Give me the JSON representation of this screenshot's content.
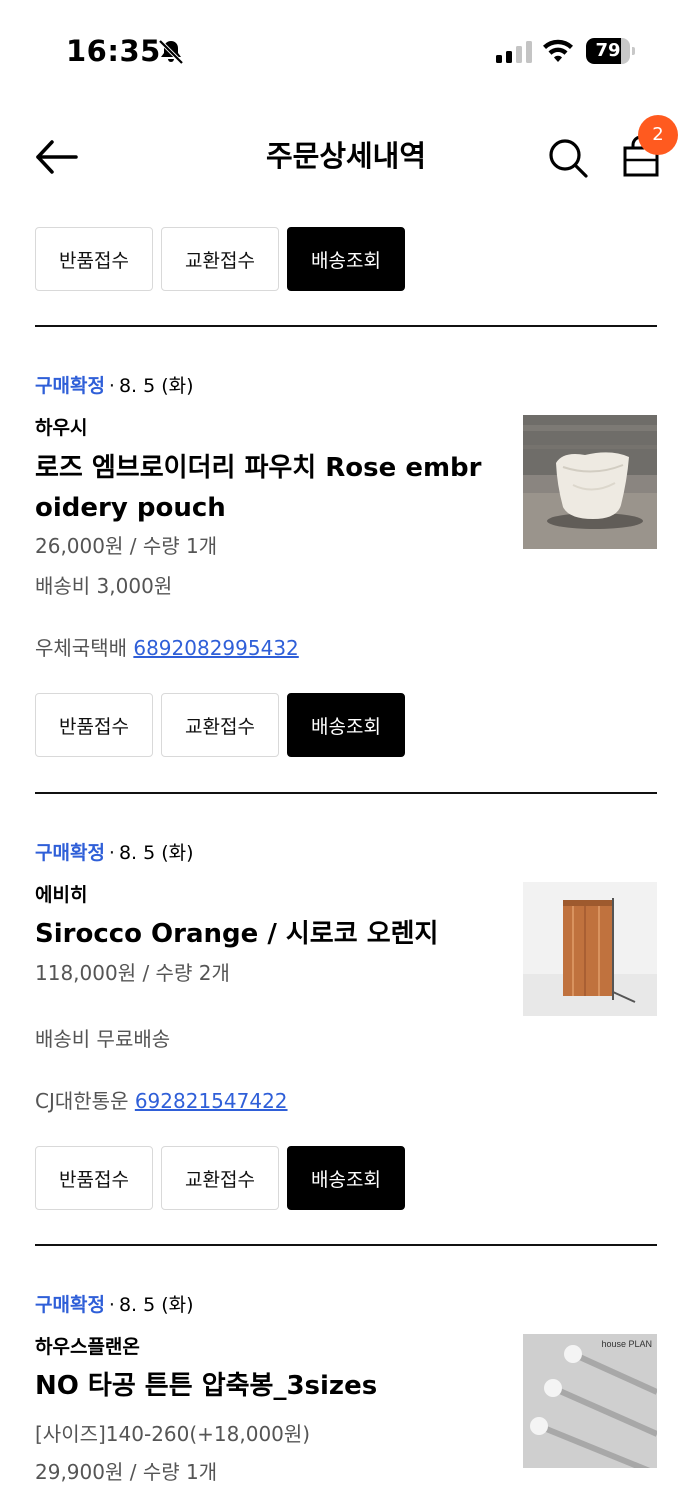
{
  "status_bar": {
    "time": "16:35",
    "battery": "79"
  },
  "header": {
    "title": "주문상세내역",
    "cart_count": "2"
  },
  "actions": {
    "return": "반품접수",
    "exchange": "교환접수",
    "track": "배송조회"
  },
  "orders": [
    {
      "status": "구매확정",
      "separator": "·",
      "date": "8. 5 (화)",
      "shop": "하우시",
      "name": "로즈 엠브로이더리 파우치 Rose embroidery pouch",
      "price_qty": "26,000원 / 수량 1개",
      "shipping": "배송비 3,000원",
      "carrier": "우체국택배",
      "tracking_no": "6892082995432"
    },
    {
      "status": "구매확정",
      "separator": "·",
      "date": "8. 5 (화)",
      "shop": "에비히",
      "name": "Sirocco Orange / 시로코 오렌지",
      "price_qty": "118,000원 / 수량 2개",
      "shipping": "배송비 무료배송",
      "carrier": "CJ대한통운",
      "tracking_no": "692821547422"
    },
    {
      "status": "구매확정",
      "separator": "·",
      "date": "8. 5 (화)",
      "shop": "하우스플랜온",
      "name": "NO 타공 튼튼 압축봉_3sizes",
      "option": "[사이즈]140-260(+18,000원)",
      "price_qty": "29,900원 / 수량 1개",
      "thumb_brand": "house PLAN"
    }
  ],
  "colors": {
    "status": "#2f5fd8",
    "badge": "#ff5a1f"
  },
  "icons": [
    "bell-slash-icon",
    "signal-icon",
    "wifi-icon",
    "battery-icon",
    "back-arrow-icon",
    "search-icon",
    "shopping-bag-icon"
  ]
}
